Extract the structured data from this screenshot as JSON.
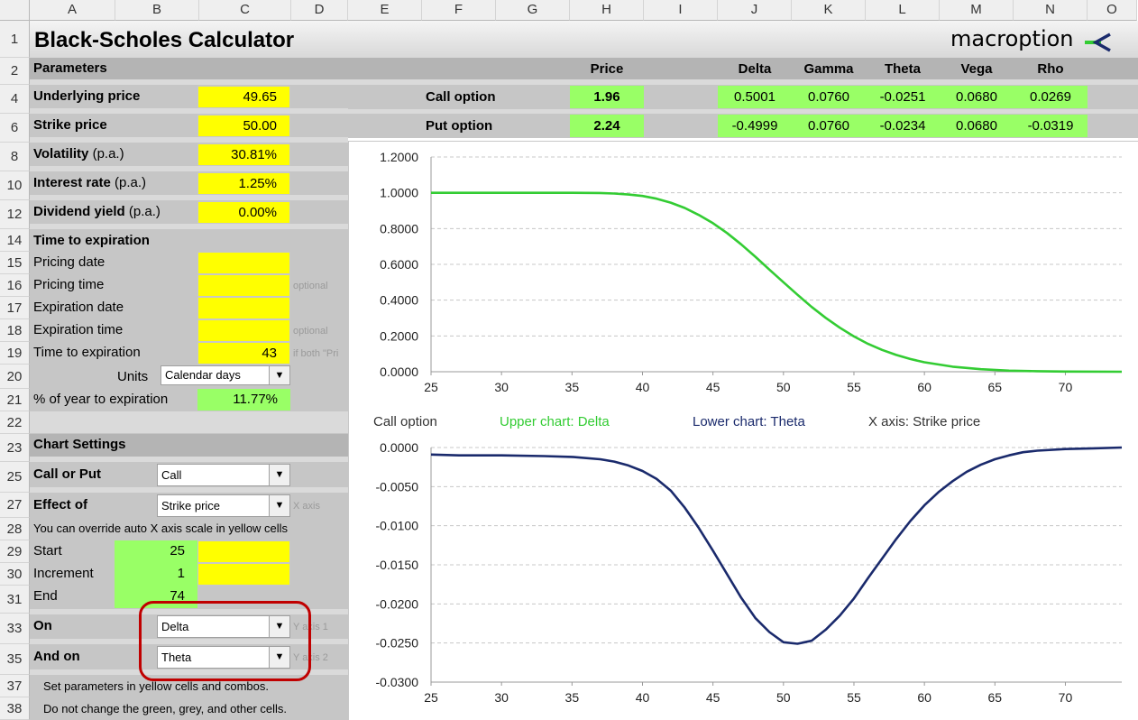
{
  "columns": [
    "A",
    "B",
    "C",
    "D",
    "E",
    "F",
    "G",
    "H",
    "I",
    "J",
    "K",
    "L",
    "M",
    "N",
    "O"
  ],
  "rows": [
    "1",
    "2",
    "4",
    "6",
    "8",
    "10",
    "12",
    "14",
    "15",
    "16",
    "17",
    "18",
    "19",
    "20",
    "21",
    "22",
    "23",
    "25",
    "27",
    "28",
    "29",
    "30",
    "31",
    "33",
    "35",
    "37",
    "38"
  ],
  "title": "Black-Scholes Calculator",
  "logo": "macroption",
  "parameters": {
    "header": "Parameters",
    "underlying_label": "Underlying price",
    "underlying": "49.65",
    "strike_label": "Strike price",
    "strike": "50.00",
    "vol_label": "Volatility",
    "vol_suffix": "(p.a.)",
    "vol": "30.81%",
    "rate_label": "Interest rate",
    "rate_suffix": "(p.a.)",
    "rate": "1.25%",
    "div_label": "Dividend yield",
    "div_suffix": "(p.a.)",
    "div": "0.00%"
  },
  "time": {
    "header": "Time to expiration",
    "pricing_date": "Pricing date",
    "pricing_time": "Pricing time",
    "expiration_date": "Expiration date",
    "expiration_time": "Expiration time",
    "tte_label": "Time to expiration",
    "tte": "43",
    "optional": "optional",
    "if_both": "if both \"Pri",
    "units_label": "Units",
    "units": "Calendar days",
    "pct_label": "% of year to expiration",
    "pct": "11.77%"
  },
  "chart_settings": {
    "header": "Chart Settings",
    "callput_label": "Call or Put",
    "callput": "Call",
    "effect_label": "Effect of",
    "effect": "Strike price",
    "x_axis_hint": "X axis",
    "override_note": "You can override auto X axis scale in yellow cells",
    "start_label": "Start",
    "start": "25",
    "inc_label": "Increment",
    "inc": "1",
    "end_label": "End",
    "end": "74",
    "on_label": "On",
    "on": "Delta",
    "y1_hint": "Y axis 1",
    "andon_label": "And on",
    "andon": "Theta",
    "y2_hint": "Y axis 2",
    "note1": "Set parameters in yellow cells and combos.",
    "note2": "Do not change the green, grey, and other cells."
  },
  "results": {
    "headers": {
      "price": "Price",
      "delta": "Delta",
      "gamma": "Gamma",
      "theta": "Theta",
      "vega": "Vega",
      "rho": "Rho"
    },
    "call": {
      "label": "Call option",
      "price": "1.96",
      "delta": "0.5001",
      "gamma": "0.0760",
      "theta": "-0.0251",
      "vega": "0.0680",
      "rho": "0.0269"
    },
    "put": {
      "label": "Put option",
      "price": "2.24",
      "delta": "-0.4999",
      "gamma": "0.0760",
      "theta": "-0.0234",
      "vega": "0.0680",
      "rho": "-0.0319"
    }
  },
  "chart_caption": {
    "option": "Call option",
    "upper": "Upper chart: Delta",
    "lower": "Lower chart: Theta",
    "xaxis": "X axis: Strike price"
  },
  "colors": {
    "accent_green": "#33cc33",
    "theta_navy": "#1a2a6c",
    "highlight_red": "#c00000"
  },
  "chart_data": [
    {
      "type": "line",
      "title": "",
      "xlabel": "",
      "ylabel": "",
      "xlim": [
        25,
        74
      ],
      "ylim": [
        0,
        1.2
      ],
      "x_ticks": [
        25,
        30,
        35,
        40,
        45,
        50,
        55,
        60,
        65,
        70
      ],
      "y_ticks": [
        "0.0000",
        "0.2000",
        "0.4000",
        "0.6000",
        "0.8000",
        "1.0000",
        "1.2000"
      ],
      "grid": true,
      "series": [
        {
          "values": [
            [
              25,
              1.0
            ],
            [
              30,
              1.0
            ],
            [
              35,
              1.0
            ],
            [
              37,
              0.999
            ],
            [
              38,
              0.996
            ],
            [
              39,
              0.99
            ],
            [
              40,
              0.982
            ],
            [
              41,
              0.967
            ],
            [
              42,
              0.945
            ],
            [
              43,
              0.915
            ],
            [
              44,
              0.876
            ],
            [
              45,
              0.83
            ],
            [
              46,
              0.775
            ],
            [
              47,
              0.712
            ],
            [
              48,
              0.643
            ],
            [
              49,
              0.571
            ],
            [
              50,
              0.5
            ],
            [
              51,
              0.43
            ],
            [
              52,
              0.362
            ],
            [
              53,
              0.301
            ],
            [
              54,
              0.246
            ],
            [
              55,
              0.197
            ],
            [
              56,
              0.156
            ],
            [
              57,
              0.122
            ],
            [
              58,
              0.094
            ],
            [
              59,
              0.071
            ],
            [
              60,
              0.053
            ],
            [
              62,
              0.028
            ],
            [
              64,
              0.014
            ],
            [
              66,
              0.006
            ],
            [
              68,
              0.003
            ],
            [
              70,
              0.001
            ],
            [
              74,
              0.0
            ]
          ]
        }
      ]
    },
    {
      "type": "line",
      "title": "",
      "xlabel": "",
      "ylabel": "",
      "xlim": [
        25,
        74
      ],
      "ylim": [
        -0.03,
        0
      ],
      "x_ticks": [
        25,
        30,
        35,
        40,
        45,
        50,
        55,
        60,
        65,
        70
      ],
      "y_ticks": [
        "-0.0300",
        "-0.0250",
        "-0.0200",
        "-0.0150",
        "-0.0100",
        "-0.0050",
        "0.0000"
      ],
      "grid": true,
      "series": [
        {
          "values": [
            [
              25,
              -0.0009
            ],
            [
              27,
              -0.001
            ],
            [
              30,
              -0.001
            ],
            [
              33,
              -0.0011
            ],
            [
              35,
              -0.0012
            ],
            [
              37,
              -0.0015
            ],
            [
              38,
              -0.0018
            ],
            [
              39,
              -0.0023
            ],
            [
              40,
              -0.003
            ],
            [
              41,
              -0.004
            ],
            [
              42,
              -0.0055
            ],
            [
              43,
              -0.0077
            ],
            [
              44,
              -0.0103
            ],
            [
              45,
              -0.0132
            ],
            [
              46,
              -0.0162
            ],
            [
              47,
              -0.0192
            ],
            [
              48,
              -0.0218
            ],
            [
              49,
              -0.0236
            ],
            [
              50,
              -0.0249
            ],
            [
              51,
              -0.0251
            ],
            [
              52,
              -0.0247
            ],
            [
              53,
              -0.0233
            ],
            [
              54,
              -0.0215
            ],
            [
              55,
              -0.0193
            ],
            [
              56,
              -0.0167
            ],
            [
              57,
              -0.0142
            ],
            [
              58,
              -0.0117
            ],
            [
              59,
              -0.0094
            ],
            [
              60,
              -0.0074
            ],
            [
              61,
              -0.0057
            ],
            [
              62,
              -0.0043
            ],
            [
              63,
              -0.0031
            ],
            [
              64,
              -0.0022
            ],
            [
              65,
              -0.0015
            ],
            [
              66,
              -0.001
            ],
            [
              67,
              -0.0006
            ],
            [
              68,
              -0.0004
            ],
            [
              70,
              -0.0002
            ],
            [
              72,
              -0.0001
            ],
            [
              74,
              0.0
            ]
          ]
        }
      ]
    }
  ]
}
